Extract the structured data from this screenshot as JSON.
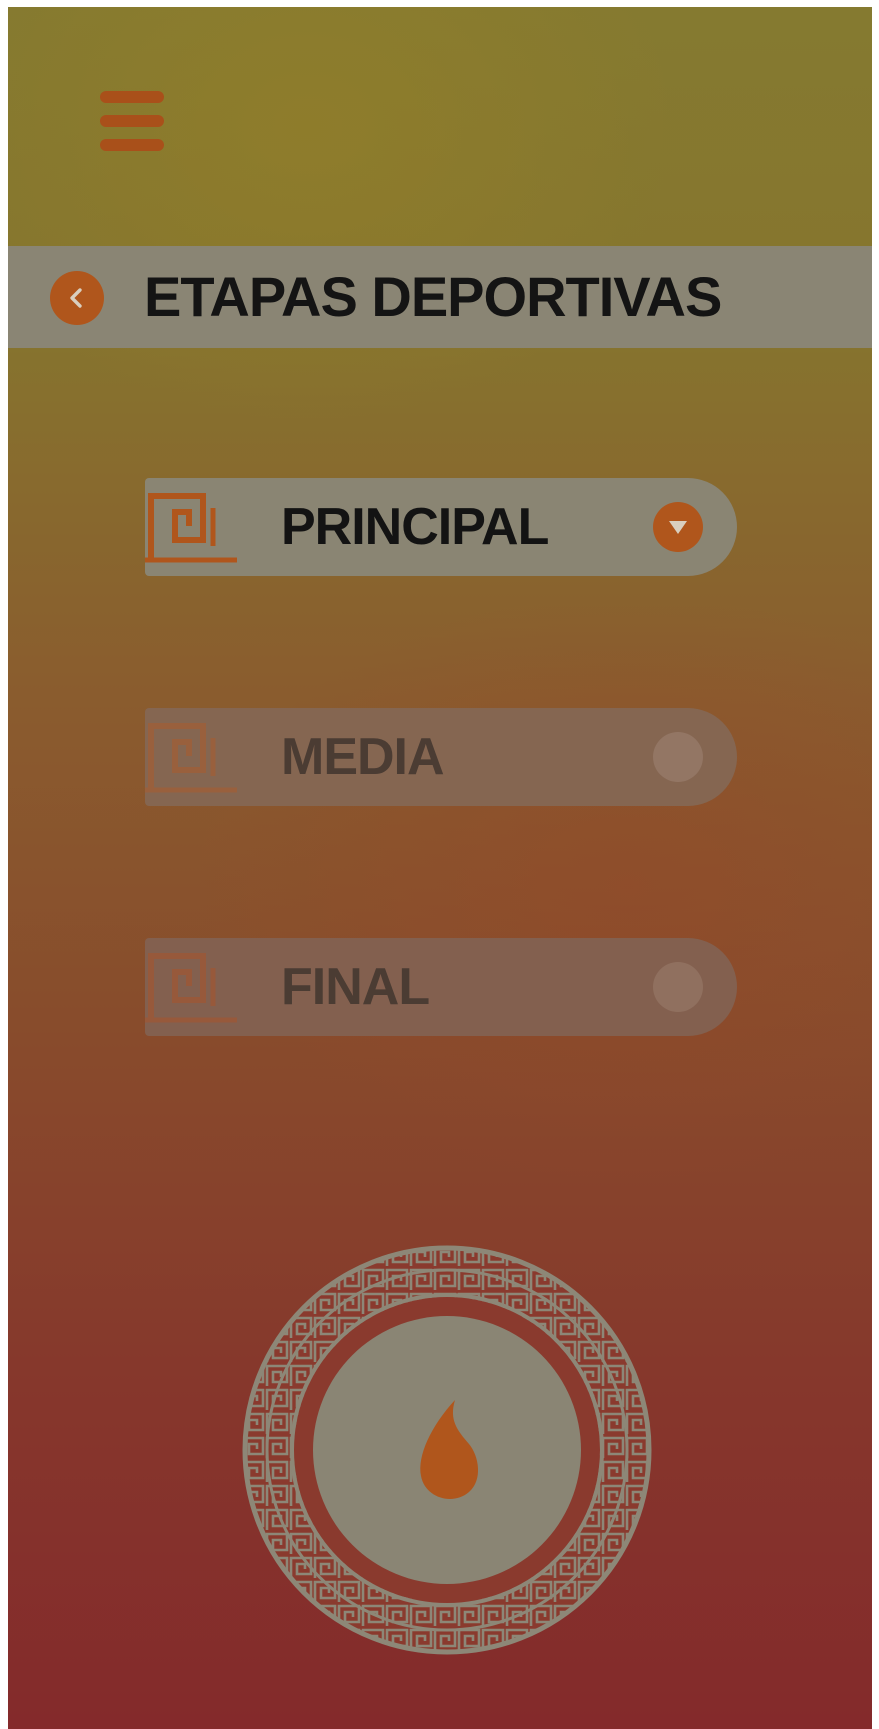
{
  "header": {
    "title": "ETAPAS DEPORTIVAS"
  },
  "menu_icon": "hamburger-menu-icon",
  "back_icon": "chevron-left-icon",
  "stages": [
    {
      "label": "PRINCIPAL",
      "state": "selected",
      "toggle_icon": "chevron-down-icon"
    },
    {
      "label": "MEDIA",
      "state": "disabled",
      "toggle_icon": "circle-icon"
    },
    {
      "label": "FINAL",
      "state": "disabled",
      "toggle_icon": "circle-icon"
    }
  ],
  "emblem": {
    "center_icon": "flame-icon",
    "border_pattern": "greek-key-pattern"
  },
  "colors": {
    "accent": "#b0561c",
    "bar": "#8a8574",
    "gradient_top": "#857a30",
    "gradient_bottom": "#842a2b"
  }
}
